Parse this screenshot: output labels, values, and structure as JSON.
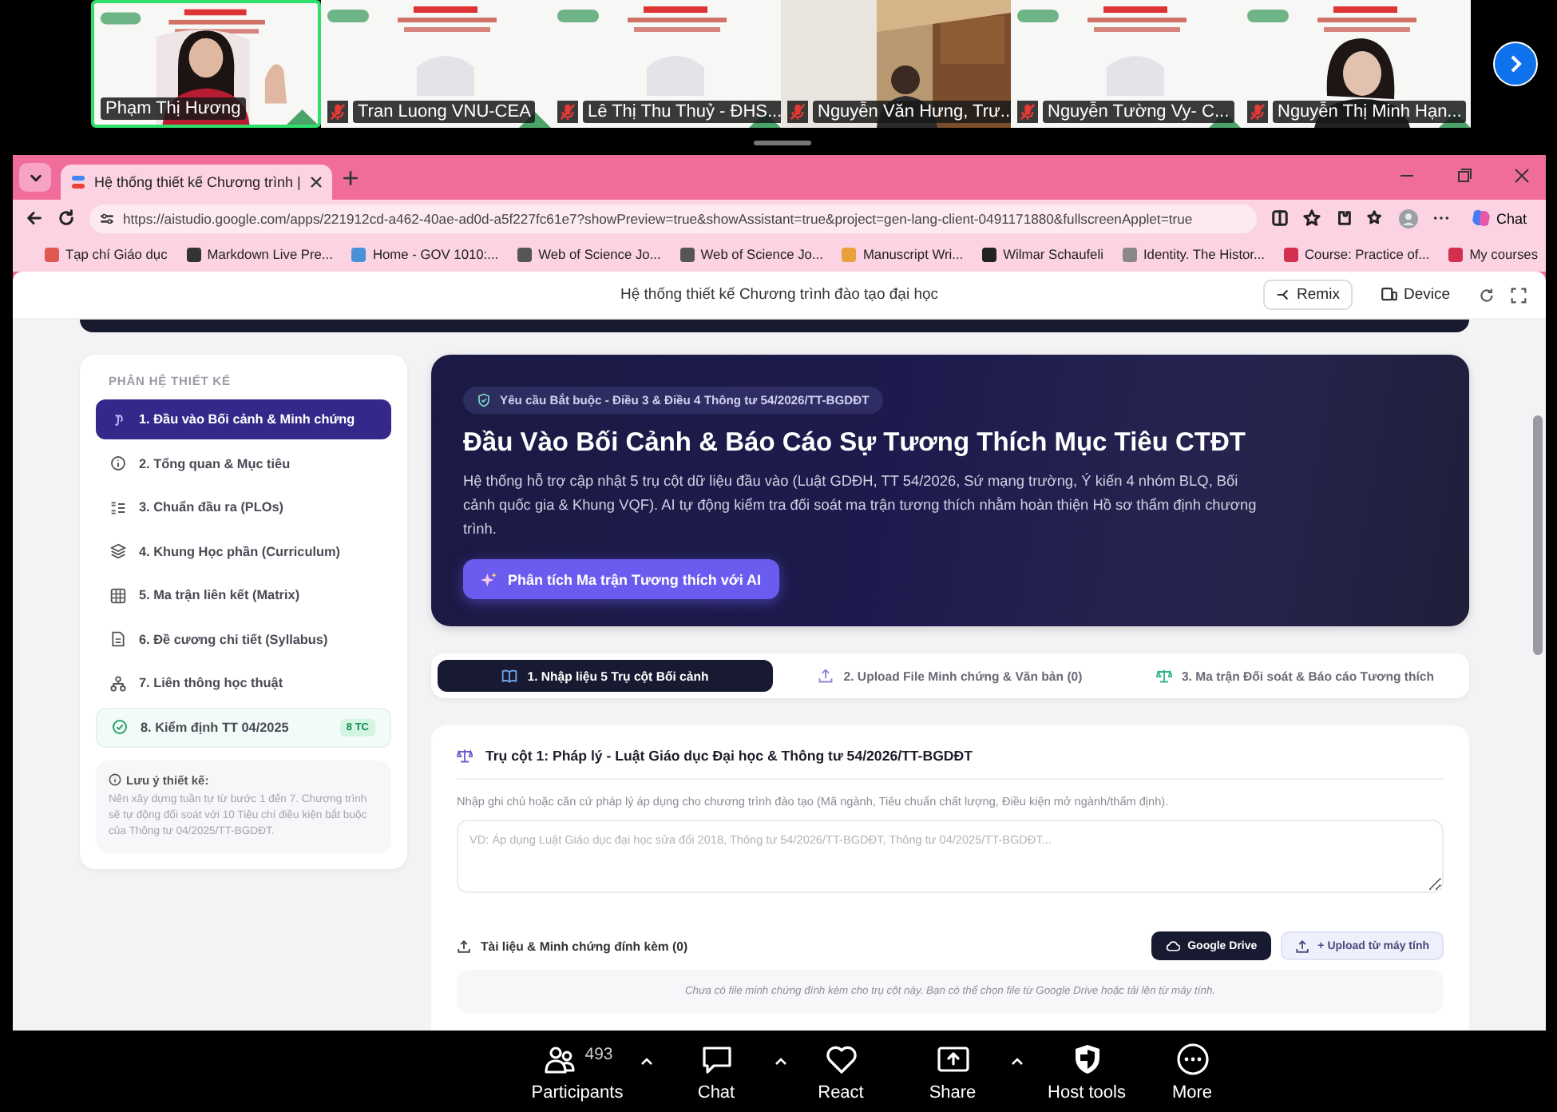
{
  "meeting": {
    "tiles": [
      {
        "name": "Phạm Thị Hương",
        "muted": false,
        "selected": true
      },
      {
        "name": "Tran Luong VNU-CEA",
        "muted": true,
        "selected": false
      },
      {
        "name": "Lê Thị Thu Thuỷ - ĐHS...",
        "muted": true,
        "selected": false
      },
      {
        "name": "Nguyễn Văn Hưng, Trư...",
        "muted": true,
        "selected": false
      },
      {
        "name": "Nguyễn Tường Vy- C...",
        "muted": true,
        "selected": false
      },
      {
        "name": "Nguyễn Thị Minh Hạn...",
        "muted": true,
        "selected": false
      }
    ]
  },
  "browser": {
    "tab": {
      "title": "Hệ thống thiết kế Chương trình |"
    },
    "url": "https://aistudio.google.com/apps/221912cd-a462-40ae-ad0d-a5f227fc61e7?showPreview=true&showAssistant=true&project=gen-lang-client-0491171880&fullscreenApplet=true",
    "assistant_button": "Chat",
    "bookmarks": [
      {
        "label": "Tạp chí Giáo dục",
        "color": "#e0584f"
      },
      {
        "label": "Markdown Live Pre...",
        "color": "#333333"
      },
      {
        "label": "Home - GOV 1010:...",
        "color": "#4a90d9"
      },
      {
        "label": "Web of Science Jo...",
        "color": "#555555"
      },
      {
        "label": "Web of Science Jo...",
        "color": "#555555"
      },
      {
        "label": "Manuscript Wri...",
        "color": "#e8a13a"
      },
      {
        "label": "Wilmar Schaufeli",
        "color": "#222222"
      },
      {
        "label": "Identity. The Histor...",
        "color": "#888888"
      },
      {
        "label": "Course: Practice of...",
        "color": "#d32f4f"
      },
      {
        "label": "My courses",
        "color": "#d32f4f"
      }
    ]
  },
  "app": {
    "title": "Hệ thống thiết kế Chương trình đào tạo đại học",
    "header_buttons": [
      {
        "label": "Remix",
        "kind": "outlined"
      },
      {
        "label": "Device",
        "kind": "plain"
      }
    ],
    "sidebar": {
      "heading": "PHÂN HỆ THIẾT KẾ",
      "items": [
        {
          "label": "1. Đầu vào Bối cảnh & Minh chứng",
          "selected": true,
          "kind": "step"
        },
        {
          "label": "2. Tổng quan & Mục tiêu",
          "selected": false,
          "kind": "step"
        },
        {
          "label": "3. Chuẩn đầu ra (PLOs)",
          "selected": false,
          "kind": "step"
        },
        {
          "label": "4. Khung Học phần (Curriculum)",
          "selected": false,
          "kind": "step"
        },
        {
          "label": "5. Ma trận liên kết (Matrix)",
          "selected": false,
          "kind": "step"
        },
        {
          "label": "6. Đề cương chi tiết (Syllabus)",
          "selected": false,
          "kind": "step"
        },
        {
          "label": "7. Liên thông học thuật",
          "selected": false,
          "kind": "step"
        },
        {
          "label": "8. Kiểm định TT 04/2025",
          "selected": false,
          "kind": "audit",
          "badge": "8 TC"
        }
      ],
      "note": {
        "title": "Lưu ý thiết kế:",
        "text": "Nên xây dựng tuần tự từ bước 1 đến 7. Chương trình sẽ tự động đối soát với 10 Tiêu chí điều kiện bắt buộc của Thông tư 04/2025/TT-BGDĐT."
      }
    },
    "hero": {
      "badge": "Yêu cầu Bắt buộc - Điều 3 & Điều 4 Thông tư 54/2026/TT-BGDĐT",
      "title": "Đầu Vào Bối Cảnh & Báo Cáo Sự Tương Thích Mục Tiêu CTĐT",
      "description": "Hệ thống hỗ trợ cập nhật 5 trụ cột dữ liệu đầu vào (Luật GDĐH, TT 54/2026, Sứ mạng trường, Ý kiến 4 nhóm BLQ, Bối cảnh quốc gia & Khung VQF). AI tự động kiểm tra đối soát ma trận tương thích nhằm hoàn thiện Hồ sơ thẩm định chương trình.",
      "button": "Phân tích Ma trận Tương thích với AI"
    },
    "tabs": [
      {
        "label": "1. Nhập liệu 5 Trụ cột Bối cảnh",
        "selected": true
      },
      {
        "label": "2. Upload File Minh chứng & Văn bản (0)",
        "selected": false
      },
      {
        "label": "3. Ma trận Đối soát & Báo cáo Tương thích",
        "selected": false
      }
    ],
    "pillar": {
      "title": "Trụ cột 1: Pháp lý - Luật Giáo dục Đại học & Thông tư 54/2026/TT-BGDĐT",
      "hint": "Nhập ghi chú hoặc căn cứ pháp lý áp dụng cho chương trình đào tạo (Mã ngành, Tiêu chuẩn chất lượng, Điều kiện mở ngành/thẩm định).",
      "placeholder": "VD: Áp dụng Luật Giáo dục đại học sửa đổi 2018, Thông tư 54/2026/TT-BGDĐT, Thông tư 04/2025/TT-BGDĐT...",
      "attachments_label": "Tài liệu & Minh chứng đính kèm (0)",
      "buttons": [
        {
          "label": "Google Drive",
          "kind": "dark"
        },
        {
          "label": "+ Upload từ máy tính",
          "kind": "light"
        }
      ],
      "empty_text": "Chưa có file minh chứng đính kèm cho trụ cột này. Bạn có thể chọn file từ Google Drive hoặc tải lên từ máy tính."
    }
  },
  "toolbar": {
    "items": [
      {
        "label": "Participants",
        "count": "493",
        "menu": true
      },
      {
        "label": "Chat",
        "menu": true
      },
      {
        "label": "React",
        "menu": false
      },
      {
        "label": "Share",
        "menu": true
      },
      {
        "label": "Host tools",
        "menu": false
      },
      {
        "label": "More",
        "menu": false
      }
    ]
  }
}
